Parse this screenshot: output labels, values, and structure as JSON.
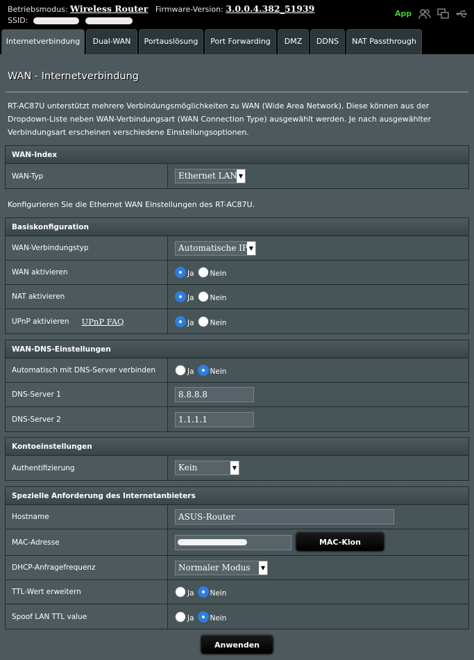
{
  "header": {
    "mode_label": "Betriebsmodus:",
    "mode_value": "Wireless Router",
    "firmware_label": "Firmware-Version:",
    "firmware_value": "3.0.0.4.382_51939",
    "ssid_label": "SSID:",
    "app_label": "App",
    "icons": [
      "users-icon",
      "copy-window-icon",
      "usb-icon"
    ]
  },
  "tabs": [
    {
      "label": "Internetverbindung",
      "active": true
    },
    {
      "label": "Dual-WAN"
    },
    {
      "label": "Portauslösung"
    },
    {
      "label": "Port Forwarding"
    },
    {
      "label": "DMZ"
    },
    {
      "label": "DDNS"
    },
    {
      "label": "NAT Passthrough"
    }
  ],
  "page": {
    "title": "WAN - Internetverbindung",
    "intro": "RT-AC87U unterstützt mehrere Verbindungsmöglichkeiten zu WAN (Wide Area Network). Diese können aus der Dropdown-Liste neben WAN-Verbindungsart (WAN Connection Type) ausgewählt werden. Je nach ausgewählter Verbindungsart erscheinen verschiedene Einstellungsoptionen.",
    "ethernet_note": "Konfigurieren Sie die Ethernet WAN Einstellungen des RT-AC87U."
  },
  "wan_index": {
    "header": "WAN-Index",
    "wan_type_label": "WAN-Typ",
    "wan_type_value": "Ethernet LAN"
  },
  "basic": {
    "header": "Basiskonfiguration",
    "conn_type_label": "WAN-Verbindungstyp",
    "conn_type_value": "Automatische IP",
    "wan_enable_label": "WAN aktivieren",
    "nat_enable_label": "NAT aktivieren",
    "upnp_enable_label": "UPnP aktivieren",
    "upnp_faq": "UPnP FAQ",
    "yes": "Ja",
    "no": "Nein"
  },
  "dns": {
    "header": "WAN-DNS-Einstellungen",
    "auto_label": "Automatisch mit DNS-Server verbinden",
    "dns1_label": "DNS-Server 1",
    "dns1_value": "8.8.8.8",
    "dns2_label": "DNS-Server 2",
    "dns2_value": "1.1.1.1"
  },
  "account": {
    "header": "Kontoeinstellungen",
    "auth_label": "Authentifizierung",
    "auth_value": "Kein"
  },
  "isp": {
    "header": "Spezielle Anforderung des Internetanbieters",
    "hostname_label": "Hostname",
    "hostname_value": "ASUS-Router",
    "mac_label": "MAC-Adresse",
    "mac_clone_button": "MAC-Klon",
    "dhcp_label": "DHCP-Anfragefrequenz",
    "dhcp_value": "Normaler Modus",
    "ttl_label": "TTL-Wert erweitern",
    "spoof_label": "Spoof LAN TTL value"
  },
  "apply_button": "Anwenden",
  "colors": {
    "background": "#4d595d",
    "header_black": "#000000",
    "radio_selected": "#2f7de1",
    "app_green": "#48c82f"
  }
}
